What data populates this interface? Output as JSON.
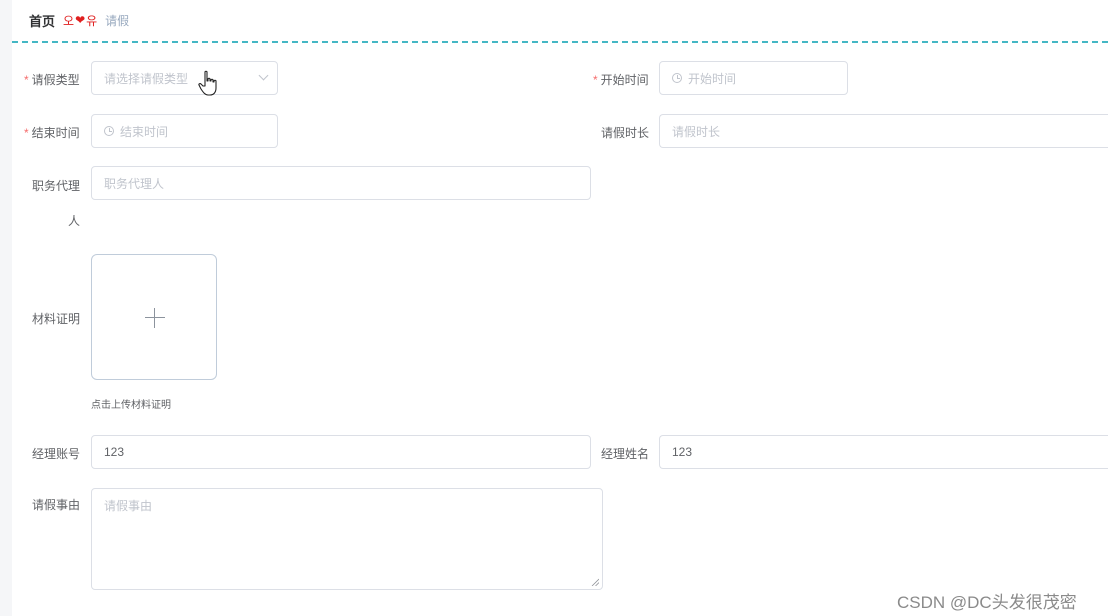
{
  "breadcrumb": {
    "home": "首页",
    "separator_left": "오",
    "separator_right": "유",
    "current": "请假"
  },
  "form": {
    "leave_type": {
      "label": "请假类型",
      "placeholder": "请选择请假类型",
      "required": true
    },
    "start_time": {
      "label": "开始时间",
      "placeholder": "开始时间",
      "required": true
    },
    "end_time": {
      "label": "结束时间",
      "placeholder": "结束时间",
      "required": true
    },
    "duration": {
      "label": "请假时长",
      "placeholder": "请假时长"
    },
    "agent": {
      "label_line1": "职务代理",
      "label_line2": "人",
      "placeholder": "职务代理人"
    },
    "material": {
      "label": "材料证明",
      "tip": "点击上传材料证明"
    },
    "manager_account": {
      "label": "经理账号",
      "value": "123"
    },
    "manager_name": {
      "label": "经理姓名",
      "value": "123"
    },
    "reason": {
      "label": "请假事由",
      "placeholder": "请假事由"
    },
    "required_mark": "*"
  },
  "watermark": "CSDN @DC头发很茂密",
  "colors": {
    "accent_dash": "#44b7c4",
    "required": "#f56c6c",
    "border": "#dcdfe6",
    "placeholder": "#c0c4cc"
  },
  "icons": {
    "heart": "heart-icon",
    "clock": "clock-icon",
    "chevron": "chevron-down-icon",
    "plus": "plus-icon",
    "cursor": "hand-cursor-icon"
  }
}
